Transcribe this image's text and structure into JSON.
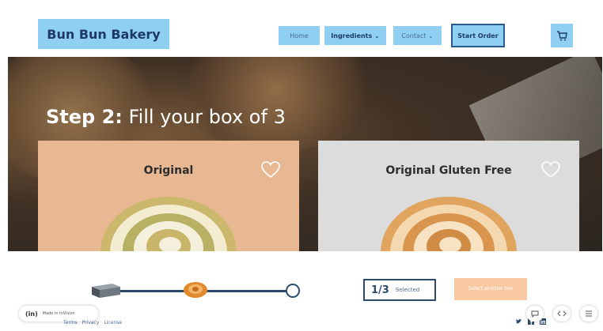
{
  "header": {
    "brand": "Bun Bun Bakery",
    "nav": {
      "home": "Home",
      "ingredients": "Ingredients ⌄",
      "contact": "Contact ⌄",
      "start_order": "Start Order"
    },
    "cart_icon": "cart-icon"
  },
  "hero": {
    "step_label": "Step 2:",
    "step_text": " Fill your box of 3"
  },
  "cards": [
    {
      "title": "Original",
      "color": "#e8b893",
      "icon": "heart-icon"
    },
    {
      "title": "Original Gluten Free",
      "color": "#dcdcdc",
      "icon": "heart-icon"
    }
  ],
  "progress": {
    "count": "1/3",
    "count_sub": "Selected",
    "select_button": "Select another box"
  },
  "footer": {
    "made_logo": "(in)",
    "made_text": "Made in InVision",
    "links": [
      "Terms",
      "Privacy",
      "License"
    ],
    "social_icons": [
      "twitter-icon",
      "facebook-icon",
      "linkedin-icon"
    ]
  },
  "colors": {
    "accent": "#8fd0f2",
    "navy": "#2b4a70",
    "peach": "#f8c9a2"
  }
}
